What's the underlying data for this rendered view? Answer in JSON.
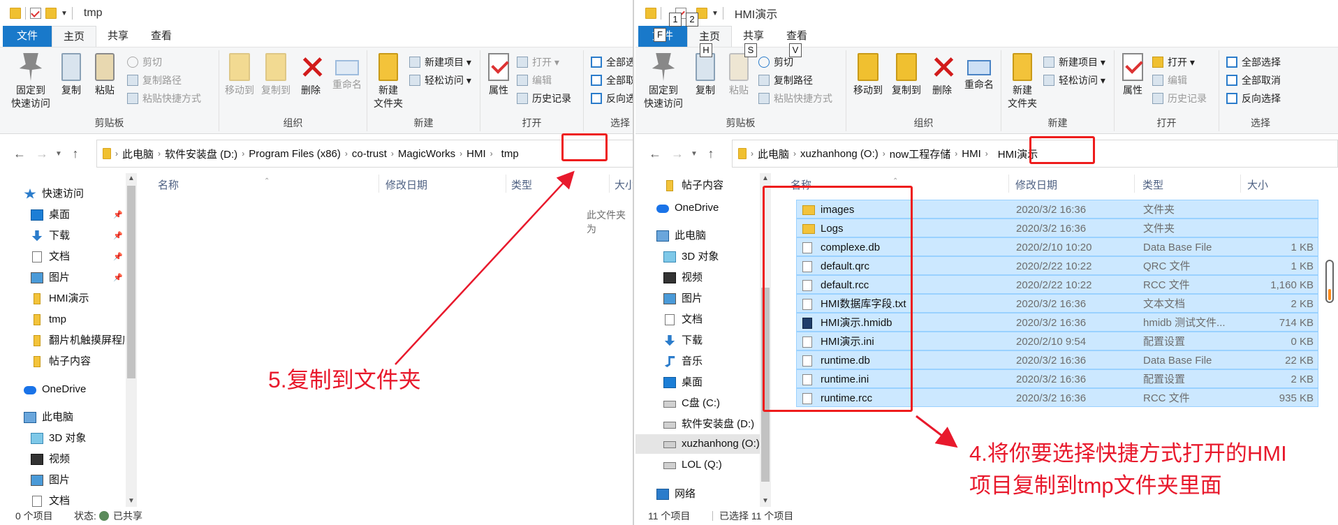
{
  "left": {
    "title": "tmp",
    "menu": {
      "file": "文件",
      "home": "主页",
      "share": "共享",
      "view": "查看"
    },
    "ribbon": {
      "pin": "固定到\n快速访问",
      "pin_l1": "固定到",
      "pin_l2": "快速访问",
      "copy": "复制",
      "paste": "粘贴",
      "cut": "剪切",
      "copy_path": "复制路径",
      "paste_shortcut": "粘贴快捷方式",
      "clipboard": "剪贴板",
      "move_to": "移动到",
      "copy_to": "复制到",
      "delete": "删除",
      "rename": "重命名",
      "organize": "组织",
      "new_folder_l1": "新建",
      "new_folder_l2": "文件夹",
      "new_item": "新建项目",
      "easy_access": "轻松访问",
      "new": "新建",
      "properties": "属性",
      "open": "打开",
      "edit": "编辑",
      "history": "历史记录",
      "open_group": "打开",
      "select_all": "全部选",
      "select_none": "全部取",
      "invert": "反向选",
      "select_group": "选择"
    },
    "address": [
      "此电脑",
      "软件安装盘 (D:)",
      "Program Files (x86)",
      "co-trust",
      "MagicWorks",
      "HMI",
      "tmp"
    ],
    "columns": {
      "name": "名称",
      "date": "修改日期",
      "type": "类型",
      "size": "大小"
    },
    "empty_text": "此文件夹为",
    "nav": [
      {
        "label": "快速访问",
        "icon": "star-icon"
      },
      {
        "label": "桌面",
        "icon": "desktop-icon"
      },
      {
        "label": "下载",
        "icon": "download-icon"
      },
      {
        "label": "文档",
        "icon": "document-icon"
      },
      {
        "label": "图片",
        "icon": "pictures-icon"
      },
      {
        "label": "HMI演示",
        "icon": "folder-icon"
      },
      {
        "label": "tmp",
        "icon": "folder-icon"
      },
      {
        "label": "翻片机触摸屏程序",
        "icon": "folder-icon"
      },
      {
        "label": "帖子内容",
        "icon": "folder-icon"
      },
      {
        "label": "OneDrive",
        "icon": "onedrive-icon"
      },
      {
        "label": "此电脑",
        "icon": "this-pc-icon"
      },
      {
        "label": "3D 对象",
        "icon": "3d-objects-icon"
      },
      {
        "label": "视频",
        "icon": "video-icon"
      },
      {
        "label": "图片",
        "icon": "pictures-icon"
      },
      {
        "label": "文档",
        "icon": "document-icon"
      }
    ],
    "status": {
      "count": "0 个项目",
      "state_label": "状态:",
      "state": "已共享"
    }
  },
  "right": {
    "title": "HMI演示",
    "hotkeys": {
      "k1": "1",
      "k2": "2",
      "f": "F",
      "h": "H",
      "s": "S",
      "v": "V"
    },
    "menu": {
      "file": "文件",
      "home": "主页",
      "share": "共享",
      "view": "查看"
    },
    "ribbon": {
      "pin_l1": "固定到",
      "pin_l2": "快速访问",
      "copy": "复制",
      "paste": "粘贴",
      "cut": "剪切",
      "copy_path": "复制路径",
      "paste_shortcut": "粘贴快捷方式",
      "clipboard": "剪贴板",
      "move_to": "移动到",
      "copy_to": "复制到",
      "delete": "删除",
      "rename": "重命名",
      "organize": "组织",
      "new_folder_l1": "新建",
      "new_folder_l2": "文件夹",
      "new_item": "新建项目",
      "easy_access": "轻松访问",
      "new": "新建",
      "properties": "属性",
      "open": "打开",
      "edit": "编辑",
      "history": "历史记录",
      "open_group": "打开",
      "select_all": "全部选择",
      "select_none": "全部取消",
      "invert": "反向选择",
      "select_group": "选择"
    },
    "address": [
      "此电脑",
      "xuzhanhong (O:)",
      "now工程存储",
      "HMI",
      "HMI演示"
    ],
    "columns": {
      "name": "名称",
      "date": "修改日期",
      "type": "类型",
      "size": "大小"
    },
    "nav": [
      {
        "label": "帖子内容",
        "icon": "folder-icon"
      },
      {
        "label": "OneDrive",
        "icon": "onedrive-icon"
      },
      {
        "label": "此电脑",
        "icon": "this-pc-icon"
      },
      {
        "label": "3D 对象",
        "icon": "3d-objects-icon"
      },
      {
        "label": "视频",
        "icon": "video-icon"
      },
      {
        "label": "图片",
        "icon": "pictures-icon"
      },
      {
        "label": "文档",
        "icon": "document-icon"
      },
      {
        "label": "下载",
        "icon": "download-icon"
      },
      {
        "label": "音乐",
        "icon": "music-icon"
      },
      {
        "label": "桌面",
        "icon": "desktop-icon"
      },
      {
        "label": "C盘 (C:)",
        "icon": "drive-icon"
      },
      {
        "label": "软件安装盘 (D:)",
        "icon": "drive-icon"
      },
      {
        "label": "xuzhanhong (O:)",
        "icon": "network-drive-icon"
      },
      {
        "label": "LOL (Q:)",
        "icon": "network-drive-icon"
      },
      {
        "label": "网络",
        "icon": "network-icon"
      }
    ],
    "files": [
      {
        "name": "images",
        "date": "2020/3/2 16:36",
        "type": "文件夹",
        "size": "",
        "icon": "folder-icon"
      },
      {
        "name": "Logs",
        "date": "2020/3/2 16:36",
        "type": "文件夹",
        "size": "",
        "icon": "folder-icon"
      },
      {
        "name": "complexe.db",
        "date": "2020/2/10 10:20",
        "type": "Data Base File",
        "size": "1 KB",
        "icon": "file-icon"
      },
      {
        "name": "default.qrc",
        "date": "2020/2/22 10:22",
        "type": "QRC 文件",
        "size": "1 KB",
        "icon": "file-icon"
      },
      {
        "name": "default.rcc",
        "date": "2020/2/22 10:22",
        "type": "RCC 文件",
        "size": "1,160 KB",
        "icon": "file-icon"
      },
      {
        "name": "HMI数据库字段.txt",
        "date": "2020/3/2 16:36",
        "type": "文本文档",
        "size": "2 KB",
        "icon": "text-file-icon"
      },
      {
        "name": "HMI演示.hmidb",
        "date": "2020/3/2 16:36",
        "type": "hmidb 测试文件...",
        "size": "714 KB",
        "icon": "hmidb-icon"
      },
      {
        "name": "HMI演示.ini",
        "date": "2020/2/10 9:54",
        "type": "配置设置",
        "size": "0 KB",
        "icon": "settings-file-icon"
      },
      {
        "name": "runtime.db",
        "date": "2020/3/2 16:36",
        "type": "Data Base File",
        "size": "22 KB",
        "icon": "file-icon"
      },
      {
        "name": "runtime.ini",
        "date": "2020/3/2 16:36",
        "type": "配置设置",
        "size": "2 KB",
        "icon": "settings-file-icon"
      },
      {
        "name": "runtime.rcc",
        "date": "2020/3/2 16:36",
        "type": "RCC 文件",
        "size": "935 KB",
        "icon": "file-icon"
      }
    ],
    "status": {
      "count": "11 个项目",
      "selected": "已选择 11 个项目"
    }
  },
  "annotations": {
    "step5": "5.复制到文件夹",
    "step4_line1": "4.将你要选择快捷方式打开的HMI",
    "step4_line2": "项目复制到tmp文件夹里面"
  },
  "colors": {
    "annotation": "#e8192c",
    "selection": "#cce8ff",
    "file_tab": "#1979ca"
  }
}
